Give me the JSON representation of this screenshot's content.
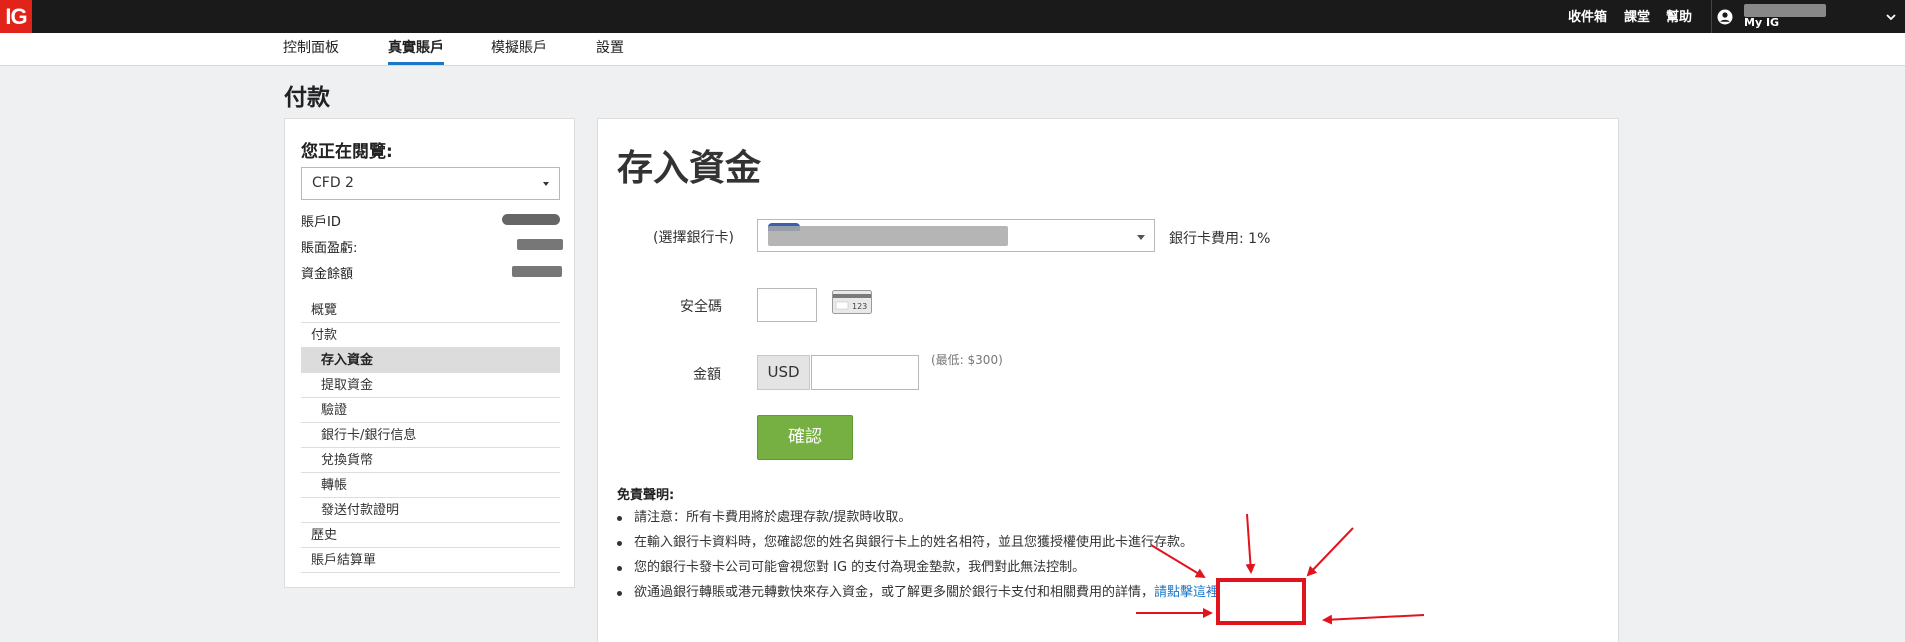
{
  "header": {
    "logo": "IG",
    "nav": [
      "收件箱",
      "課堂",
      "幫助"
    ],
    "user_label": "My IG"
  },
  "tabs": [
    {
      "label": "控制面板",
      "active": false
    },
    {
      "label": "真實賬戶",
      "active": true
    },
    {
      "label": "模擬賬戶",
      "active": false
    },
    {
      "label": "設置",
      "active": false
    }
  ],
  "page_title": "付款",
  "sidebar": {
    "title": "您正在閱覽:",
    "account_selected": "CFD 2",
    "info": [
      {
        "label": "賬戶ID"
      },
      {
        "label": "賬面盈虧:"
      },
      {
        "label": "資金餘額"
      }
    ],
    "menu": [
      {
        "label": "概覽",
        "level": "top"
      },
      {
        "label": "付款",
        "level": "top"
      },
      {
        "label": "存入資金",
        "level": "sub",
        "selected": true
      },
      {
        "label": "提取資金",
        "level": "sub"
      },
      {
        "label": "驗證",
        "level": "sub"
      },
      {
        "label": "銀行卡/銀行信息",
        "level": "sub"
      },
      {
        "label": "兌換貨幣",
        "level": "sub"
      },
      {
        "label": "轉帳",
        "level": "sub"
      },
      {
        "label": "發送付款證明",
        "level": "sub"
      },
      {
        "label": "歷史",
        "level": "top"
      },
      {
        "label": "賬戶結算單",
        "level": "top"
      }
    ]
  },
  "main": {
    "title": "存入資金",
    "card_label": "(選擇銀行卡)",
    "card_fee": "銀行卡費用: 1%",
    "cvv_label": "安全碼",
    "cvv_icon_text": "123",
    "amount_label": "金額",
    "currency": "USD",
    "minimum": "(最低: $300)",
    "confirm": "確認",
    "disclaimer_title": "免責聲明:",
    "disclaimer": [
      "請注意：所有卡費用將於處理存款/提款時收取。",
      "在輸入銀行卡資料時，您確認您的姓名與銀行卡上的姓名相符，並且您獲授權使用此卡進行存款。",
      "您的銀行卡發卡公司可能會視您對 IG 的支付為現金墊款，我們對此無法控制。",
      "欲通過銀行轉賬或港元轉數快來存入資金，或了解更多關於銀行卡支付和相關費用的詳情，"
    ],
    "disclaimer_link": "請點擊這裡"
  },
  "colors": {
    "brand_red": "#e2231a",
    "topbar": "#1a1a1a",
    "confirm_green": "#76b043",
    "link_blue": "#1a76c7",
    "annotation_red": "#e1141e"
  }
}
